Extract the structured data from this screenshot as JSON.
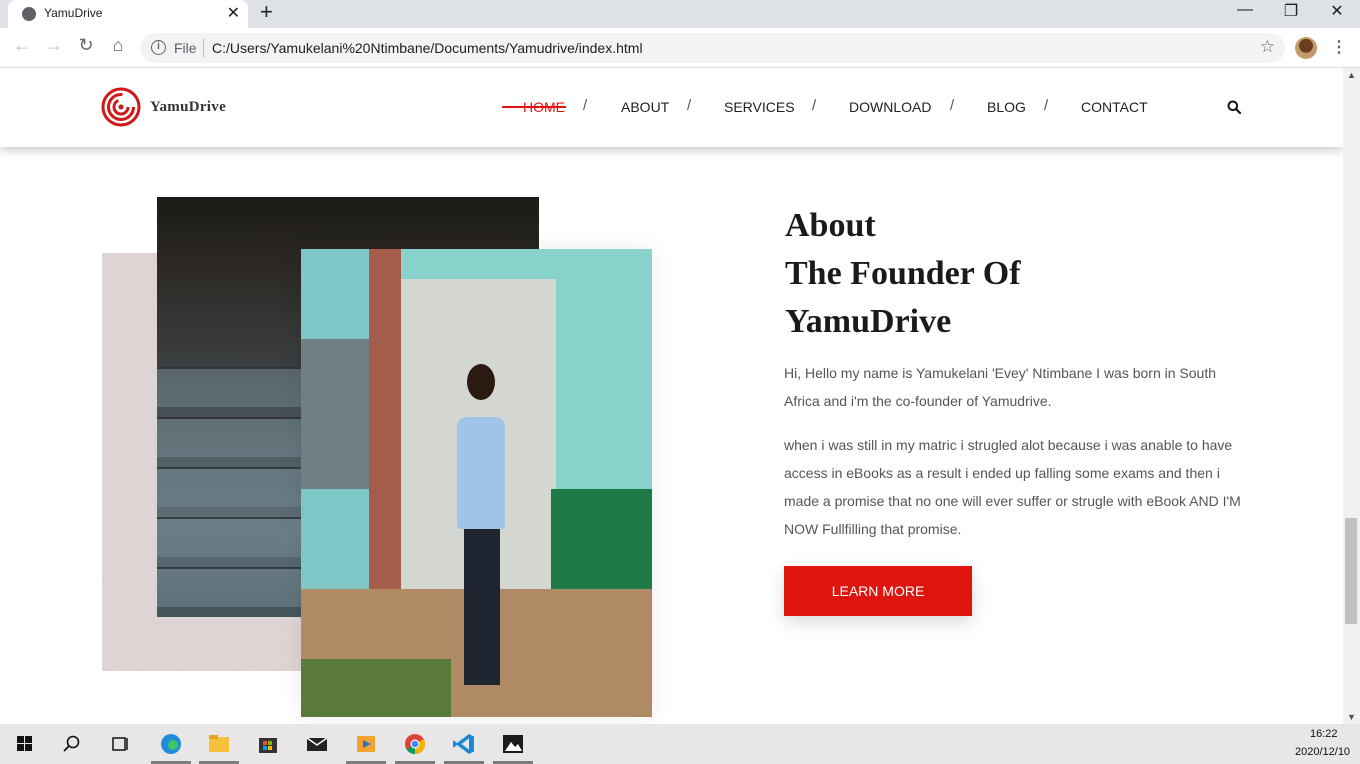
{
  "browser": {
    "tab_title": "YamuDrive",
    "tab_close": "✕",
    "new_tab": "+",
    "window_controls": {
      "minimize": "—",
      "maximize": "❐",
      "close": "✕"
    },
    "back": "←",
    "forward": "→",
    "reload": "↻",
    "home": "⌂",
    "security_label": "File",
    "url": "C:/Users/Yamukelani%20Ntimbane/Documents/Yamudrive/index.html",
    "bookmark_star": "☆",
    "menu": "⋮"
  },
  "site": {
    "logo_text": "YamuDrive",
    "nav": [
      {
        "label": "HOME",
        "active": true
      },
      {
        "label": "ABOUT"
      },
      {
        "label": "SERVICES"
      },
      {
        "label": "DOWNLOAD"
      },
      {
        "label": "BLOG"
      },
      {
        "label": "CONTACT"
      }
    ],
    "nav_separator": "/",
    "accent_color": "#e0140f"
  },
  "about": {
    "title_line1": "About",
    "title_line2": "The Founder Of",
    "title_line3": "YamuDrive",
    "paragraph1": "Hi, Hello my name is Yamukelani 'Evey' Ntimbane I was born in South Africa and i'm the co-founder of Yamudrive.",
    "paragraph2": "when i was still in my matric i strugled alot because i was anable to have access in eBooks as a result i ended up falling some exams and then i made a promise that no one will ever suffer or strugle with eBook AND I'M NOW Fullfilling that promise.",
    "button_label": "LEARN MORE"
  },
  "taskbar": {
    "time": "16:22",
    "date": "2020/12/10",
    "apps": [
      "windows-start",
      "search",
      "task-view",
      "edge",
      "file-explorer",
      "microsoft-store",
      "mail",
      "media-player",
      "chrome",
      "vscode",
      "photos"
    ]
  }
}
